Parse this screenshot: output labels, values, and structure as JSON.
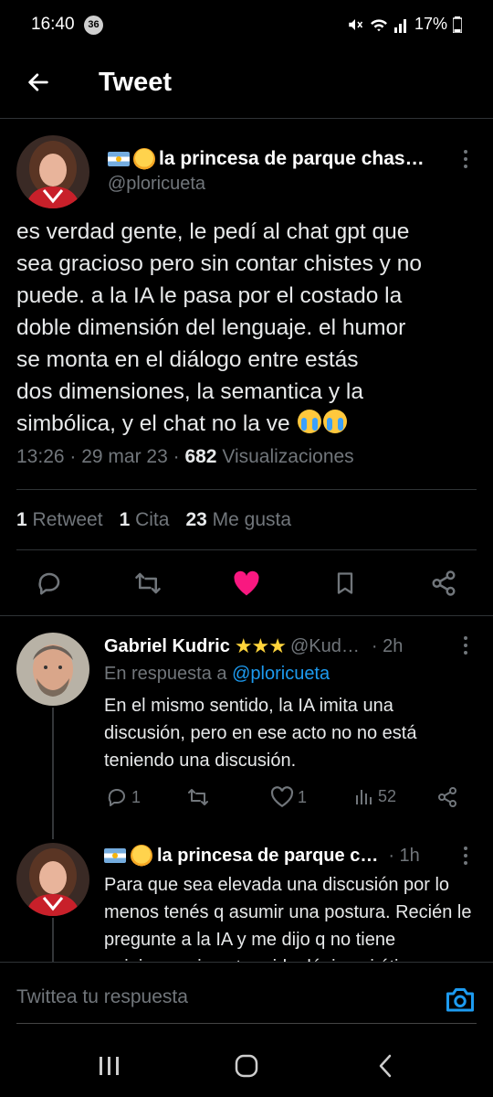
{
  "status_bar": {
    "time": "16:40",
    "badge": "36",
    "battery": "17%"
  },
  "header": {
    "title": "Tweet"
  },
  "tweet": {
    "author_name": "la princesa de parque chas…",
    "handle": "@ploricueta",
    "text": "es verdad gente, le pedí al chat gpt que\nsea gracioso pero sin contar chistes y no\npuede. a la IA le pasa por el costado la\ndoble dimensión del lenguaje. el humor\nse monta en el diálogo entre estás\ndos dimensiones, la semantica y la\nsimbólica, y el chat no la ve",
    "time": "13:26 · 29 mar 23 · ",
    "views_count": "682",
    "views_label": " Visualizaciones",
    "retweets_count": "1",
    "retweets_label": " Retweet",
    "quotes_count": "1",
    "quotes_label": " Cita",
    "likes_count": "23",
    "likes_label": " Me gusta"
  },
  "replies": [
    {
      "name": "Gabriel Kudric",
      "stars": "★★★",
      "handle": "@Kud…",
      "time": "· 2h",
      "reply_to_prefix": "En respuesta a ",
      "reply_to": "@ploricueta",
      "text": "En el mismo sentido, la IA imita una discusión, pero en ese acto no no está teniendo una discusión.",
      "reply_count": "1",
      "like_count": "1",
      "view_count": "52"
    },
    {
      "name": "la princesa de parque c…",
      "time": "· 1h",
      "text": "Para que sea elevada una discusión por lo menos tenés q asumir una postura. Recién le pregunte a la IA y me dijo q no tiene opiniones ni postura ideológica ni ética"
    }
  ],
  "composer": {
    "placeholder": "Twittea tu respuesta"
  },
  "colors": {
    "accent": "#1d9bf0",
    "like": "#f91880",
    "background": "#000000"
  }
}
